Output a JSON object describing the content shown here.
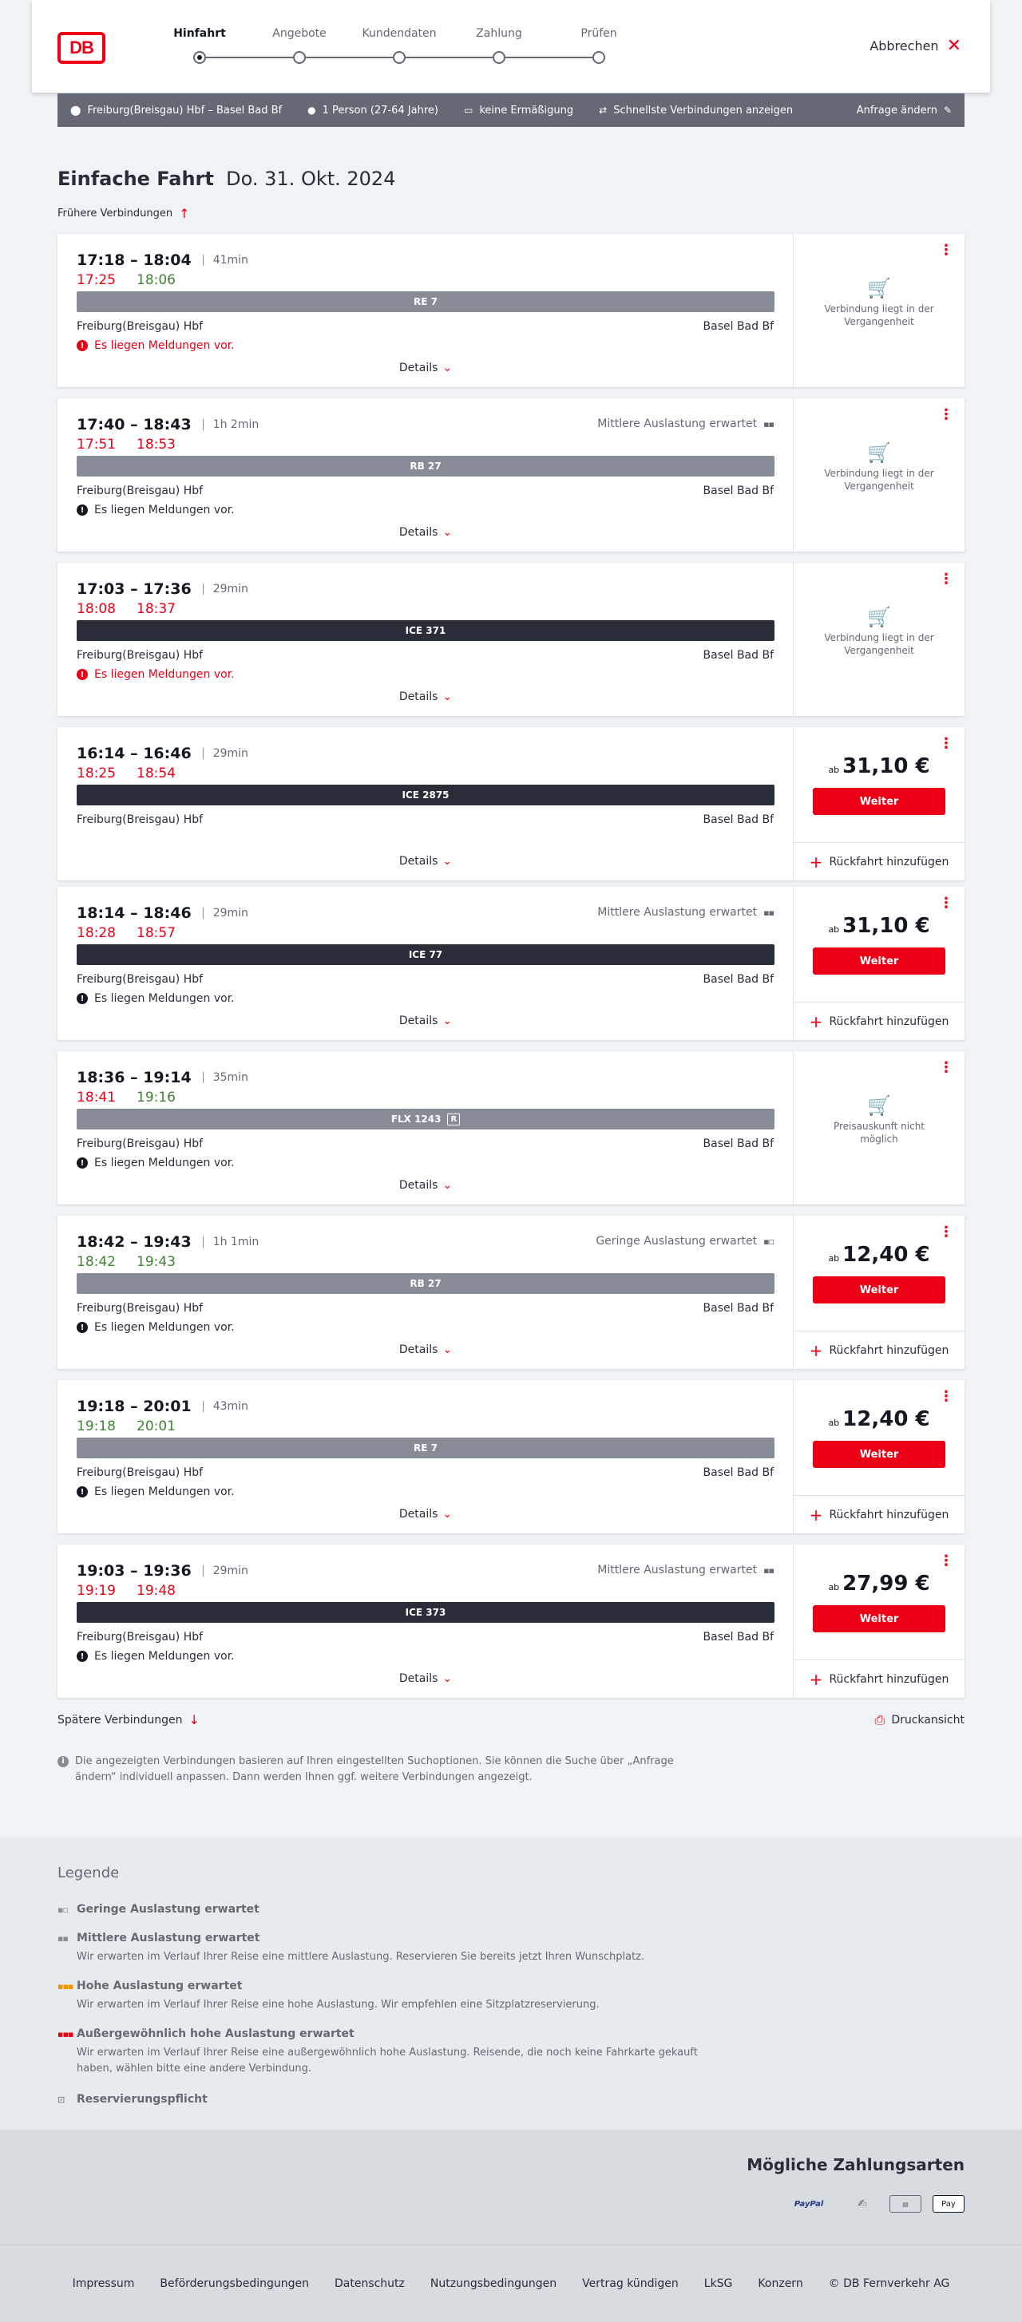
{
  "header": {
    "logo": "DB",
    "steps": [
      "Hinfahrt",
      "Angebote",
      "Kundendaten",
      "Zahlung",
      "Prüfen"
    ],
    "cancel_label": "Abbrechen"
  },
  "searchbar": {
    "route": "Freiburg(Breisgau) Hbf – Basel Bad Bf",
    "passengers": "1 Person (27-64 Jahre)",
    "discount": "keine Ermäßigung",
    "option": "Schnellste Verbindungen anzeigen",
    "change_label": "Anfrage ändern"
  },
  "page": {
    "title_bold": "Einfache Fahrt",
    "title_date": "Do. 31. Okt. 2024",
    "earlier_label": "Frühere Verbindungen",
    "later_label": "Spätere Verbindungen",
    "print_label": "Druckansicht",
    "info_text": "Die angezeigten Verbindungen basieren auf Ihren eingestellten Suchoptionen. Sie können die Suche über „Anfrage ändern“ individuell anpassen. Dann werden Ihnen ggf. weitere Verbindungen angezeigt."
  },
  "labels": {
    "details": "Details",
    "weiter": "Weiter",
    "rueckfahrt": "Rückfahrt hinzufügen",
    "ab": "ab",
    "from": "Freiburg(Breisgau) Hbf",
    "to": "Basel Bad Bf",
    "message": "Es liegen Meldungen vor."
  },
  "connections": [
    {
      "times": "17:18 – 18:04",
      "duration": "41min",
      "rt_dep": "17:25",
      "rt_dep_state": "late",
      "rt_arr": "18:06",
      "rt_arr_state": "ok",
      "train": "RE 7",
      "train_style": "gray",
      "load": "",
      "message_red": true,
      "side": "past",
      "side_text": "Verbindung liegt in der Vergangenheit"
    },
    {
      "times": "17:40 – 18:43",
      "duration": "1h 2min",
      "rt_dep": "17:51",
      "rt_dep_state": "late",
      "rt_arr": "18:53",
      "rt_arr_state": "late",
      "train": "RB 27",
      "train_style": "gray",
      "load": "Mittlere Auslastung erwartet",
      "message_red": false,
      "side": "past",
      "side_text": "Verbindung liegt in der Vergangenheit"
    },
    {
      "times": "17:03 – 17:36",
      "duration": "29min",
      "rt_dep": "18:08",
      "rt_dep_state": "late",
      "rt_arr": "18:37",
      "rt_arr_state": "late",
      "train": "ICE 371",
      "train_style": "dark",
      "load": "",
      "message_red": true,
      "side": "past",
      "side_text": "Verbindung liegt in der Vergangenheit"
    },
    {
      "times": "16:14 – 16:46",
      "duration": "29min",
      "rt_dep": "18:25",
      "rt_dep_state": "late",
      "rt_arr": "18:54",
      "rt_arr_state": "late",
      "train": "ICE 2875",
      "train_style": "dark",
      "load": "",
      "message_red": null,
      "side": "price",
      "price": "31,10 €"
    },
    {
      "times": "18:14 – 18:46",
      "duration": "29min",
      "rt_dep": "18:28",
      "rt_dep_state": "late",
      "rt_arr": "18:57",
      "rt_arr_state": "late",
      "train": "ICE 77",
      "train_style": "dark",
      "load": "Mittlere Auslastung erwartet",
      "message_red": false,
      "side": "price",
      "price": "31,10 €"
    },
    {
      "times": "18:36 – 19:14",
      "duration": "35min",
      "rt_dep": "18:41",
      "rt_dep_state": "late",
      "rt_arr": "19:16",
      "rt_arr_state": "ok",
      "train": "FLX 1243",
      "train_style": "gray",
      "reservation": true,
      "load": "",
      "message_red": false,
      "side": "past",
      "side_text": "Preisauskunft nicht möglich"
    },
    {
      "times": "18:42 – 19:43",
      "duration": "1h 1min",
      "rt_dep": "18:42",
      "rt_dep_state": "ok",
      "rt_arr": "19:43",
      "rt_arr_state": "ok",
      "train": "RB 27",
      "train_style": "gray",
      "load": "Geringe Auslastung erwartet",
      "message_red": false,
      "side": "price",
      "price": "12,40 €"
    },
    {
      "times": "19:18 – 20:01",
      "duration": "43min",
      "rt_dep": "19:18",
      "rt_dep_state": "ok",
      "rt_arr": "20:01",
      "rt_arr_state": "ok",
      "train": "RE 7",
      "train_style": "gray",
      "load": "",
      "message_red": false,
      "side": "price",
      "price": "12,40 €"
    },
    {
      "times": "19:03 – 19:36",
      "duration": "29min",
      "rt_dep": "19:19",
      "rt_dep_state": "late",
      "rt_arr": "19:48",
      "rt_arr_state": "late",
      "train": "ICE 373",
      "train_style": "dark",
      "load": "Mittlere Auslastung erwartet",
      "message_red": false,
      "side": "price",
      "price": "27,99 €"
    }
  ],
  "legend": {
    "title": "Legende",
    "items": [
      {
        "title": "Geringe Auslastung erwartet",
        "desc": "",
        "color": "#878c96"
      },
      {
        "title": "Mittlere Auslastung erwartet",
        "desc": "Wir erwarten im Verlauf Ihrer Reise eine mittlere Auslastung. Reservieren Sie bereits jetzt Ihren Wunschplatz.",
        "color": "#646973"
      },
      {
        "title": "Hohe Auslastung erwartet",
        "desc": "Wir erwarten im Verlauf Ihrer Reise eine hohe Auslastung. Wir empfehlen eine Sitzplatzreservierung.",
        "color": "#f39200"
      },
      {
        "title": "Außergewöhnlich hohe Auslastung erwartet",
        "desc": "Wir erwarten im Verlauf Ihrer Reise eine außergewöhnlich hohe Auslastung. Reisende, die noch keine Fahrkarte gekauft haben, wählen bitte eine andere Verbindung.",
        "color": "#ec0016"
      },
      {
        "title": "Reservierungspflicht",
        "desc": "",
        "color": "#646973"
      }
    ]
  },
  "payment": {
    "title": "Mögliche Zahlungsarten",
    "paypal": "PayPal",
    "apple": "Pay"
  },
  "footer": [
    "Impressum",
    "Beförderungsbedingungen",
    "Datenschutz",
    "Nutzungsbedingungen",
    "Vertrag kündigen",
    "LkSG",
    "Konzern",
    "© DB Fernverkehr AG"
  ]
}
